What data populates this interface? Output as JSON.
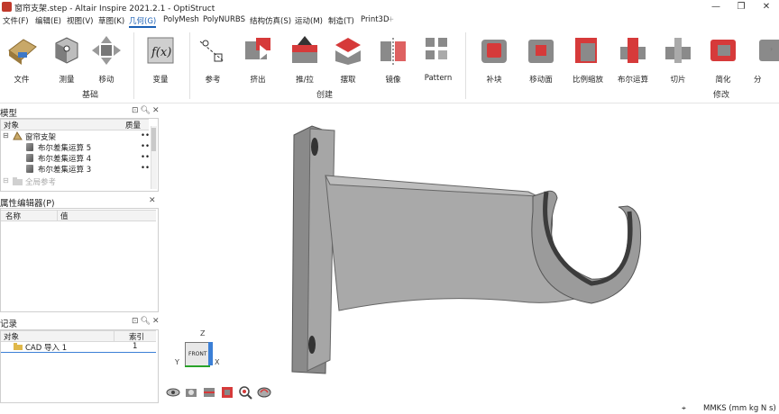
{
  "window": {
    "title": "窗帘支架.step - Altair Inspire 2021.2.1 - OptiStruct",
    "minimize": "—",
    "restore": "❐",
    "close": "✕"
  },
  "menu": [
    "文件(F)",
    "编辑(E)",
    "视图(V)",
    "草图(K)",
    "几何(G)",
    "PolyMesh",
    "PolyNURBS",
    "结构仿真(S)",
    "运动(M)",
    "制造(T)",
    "Print3D",
    "+"
  ],
  "menu_active_index": 4,
  "ribbon": {
    "tools": [
      "文件",
      "测量",
      "移动",
      "变量",
      "参考",
      "挤出",
      "推/拉",
      "摆取",
      "镜像",
      "Pattern",
      "补块",
      "移动面",
      "比例缩放",
      "布尔运算",
      "切片",
      "简化",
      "分"
    ],
    "groups": [
      "基础",
      "创建",
      "修改"
    ]
  },
  "model_panel": {
    "title": "模型",
    "col_object": "对象",
    "col_mass": "质量",
    "root": "窗帘支架",
    "root_mass": "••",
    "children": [
      {
        "label": "布尔差集运算 5",
        "mass": "••"
      },
      {
        "label": "布尔差集运算 4",
        "mass": "••"
      },
      {
        "label": "布尔差集运算 3",
        "mass": "••"
      }
    ],
    "last": "全局参考"
  },
  "property_panel": {
    "title": "属性编辑器(P)",
    "col_name": "名称",
    "col_value": "值"
  },
  "history_panel": {
    "title": "记录",
    "col_object": "对象",
    "col_index": "索引",
    "rows": [
      {
        "label": "CAD 导入 1",
        "index": "1"
      }
    ]
  },
  "viewcube": {
    "face": "FRONT",
    "axis_x": "X",
    "axis_y": "Y",
    "axis_z": "Z"
  },
  "status": {
    "units": "MMKS (mm kg N s)"
  },
  "colors": {
    "accent": "#1a5fb4",
    "part_fill": "#9b9b9b",
    "icon_red": "#d63a3a"
  }
}
